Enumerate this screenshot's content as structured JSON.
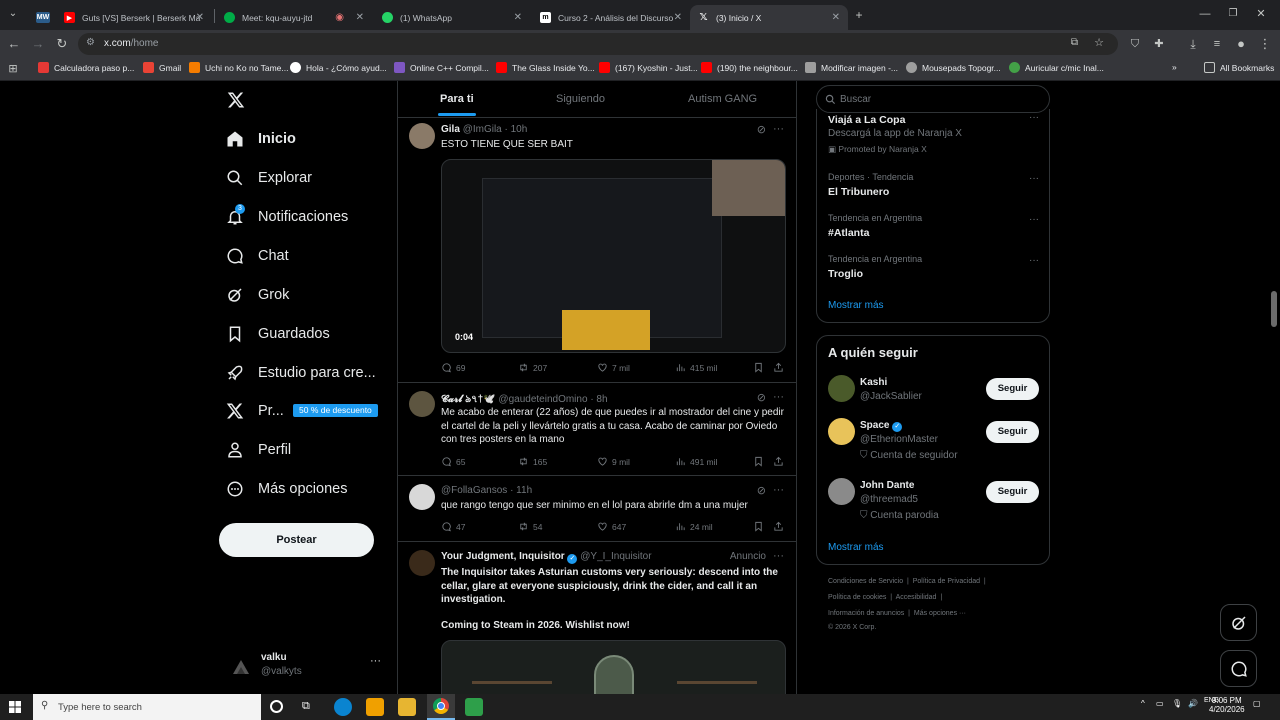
{
  "browser": {
    "tabs": [
      {
        "title": "Guts [VS] Berserk | Berserk Ma",
        "icon": "youtube-icon",
        "color": "#ff0000"
      },
      {
        "title": "Meet: kqu-auyu-jtd",
        "icon": "meet-icon",
        "color": "#00ac47"
      },
      {
        "title": "(1) WhatsApp",
        "icon": "whatsapp-icon",
        "color": "#25d366"
      },
      {
        "title": "Curso 2 - Análisis del Discurso",
        "icon": "moodle-icon",
        "color": "#ffffff"
      },
      {
        "title": "(3) Inicio / X",
        "icon": "x-icon",
        "color": "#ffffff"
      }
    ],
    "first_tab_label": "MW",
    "url_domain": "x.com",
    "url_path": "/home",
    "bookmarks": [
      {
        "label": "Calculadora paso p...",
        "color": "#e53935"
      },
      {
        "label": "Gmail",
        "color": "#ea4335"
      },
      {
        "label": "Uchi no Ko no Tame...",
        "color": "#f57c00"
      },
      {
        "label": "Hola - ¿Cómo ayud...",
        "color": "#ffffff"
      },
      {
        "label": "Online C++ Compil...",
        "color": "#7e57c2"
      },
      {
        "label": "The Glass Inside Yo...",
        "color": "#ff0000"
      },
      {
        "label": "(167) Kyoshin - Just...",
        "color": "#ff0000"
      },
      {
        "label": "(190) the neighbour...",
        "color": "#ff0000"
      },
      {
        "label": "Modificar imagen -...",
        "color": "#9e9e9e"
      },
      {
        "label": "Mousepads Topogr...",
        "color": "#9e9e9e"
      },
      {
        "label": "Auricular c/mic Inal...",
        "color": "#43a047"
      }
    ],
    "all_bookmarks": "All Bookmarks"
  },
  "nav": {
    "items": [
      {
        "label": "Inicio",
        "icon": "home-icon"
      },
      {
        "label": "Explorar",
        "icon": "search-icon"
      },
      {
        "label": "Notificaciones",
        "icon": "bell-icon"
      },
      {
        "label": "Chat",
        "icon": "chat-icon"
      },
      {
        "label": "Grok",
        "icon": "grok-icon"
      },
      {
        "label": "Guardados",
        "icon": "bookmark-icon"
      },
      {
        "label": "Estudio para cre...",
        "icon": "rocket-icon"
      },
      {
        "label": "Pr...",
        "icon": "x-logo-icon"
      },
      {
        "label": "Perfil",
        "icon": "person-icon"
      },
      {
        "label": "Más opciones",
        "icon": "more-circle-icon"
      }
    ],
    "notif_badge": "3",
    "premium_badge": "50 % de descuento",
    "post_button": "Postear",
    "account_name": "valku",
    "account_handle": "@valkyts"
  },
  "feed": {
    "tabs": [
      "Para ti",
      "Siguiendo",
      "Autism GANG"
    ],
    "tweets": [
      {
        "name": "Gila",
        "handle": "@ImGila",
        "time": "· 10h",
        "text": "ESTO TIENE QUE SER BAIT",
        "video_time": "0:04",
        "replies": "69",
        "reposts": "207",
        "likes": "7 mil",
        "views": "415 mil"
      },
      {
        "name": "𝓒𝓪𝓻𝓵 ঌ৭†🕊️",
        "handle": "@gaudeteindOmino",
        "time": "· 8h",
        "text": "Me acabo de enterar (22 años) de que puedes ir al mostrador del cine y pedir el cartel de la peli y llevártelo gratis a tu casa. Acabo de caminar por Oviedo con tres posters en la mano",
        "replies": "65",
        "reposts": "165",
        "likes": "9 mil",
        "views": "491 mil"
      },
      {
        "name": "",
        "handle": "@FollaGansos",
        "time": "· 11h",
        "text": "que rango tengo que ser minimo en el lol para abrirle dm a una mujer",
        "replies": "47",
        "reposts": "54",
        "likes": "647",
        "views": "24 mil"
      },
      {
        "name": "Your Judgment, Inquisitor",
        "handle": "@Y_I_Inquisitor",
        "time": "Anuncio",
        "text": "The Inquisitor takes Asturian customs very seriously: descend into the cellar, glare at everyone suspiciously, drink the cider, and call it an investigation.",
        "text2": "Coming to Steam in 2026. Wishlist now!"
      }
    ]
  },
  "right": {
    "search_placeholder": "Buscar",
    "trends": [
      {
        "title": "Viajá a La Copa",
        "sub": "Descargá la app de Naranja X",
        "promo": "Promoted by Naranja X"
      },
      {
        "meta": "Deportes · Tendencia",
        "title": "El Tribunero"
      },
      {
        "meta": "Tendencia en Argentina",
        "title": "#Atlanta"
      },
      {
        "meta": "Tendencia en Argentina",
        "title": "Troglio"
      }
    ],
    "show_more": "Mostrar más",
    "who_title": "A quién seguir",
    "who": [
      {
        "name": "Kashi",
        "handle": "@JackSablier",
        "sub": "",
        "color": "#4a5a2a"
      },
      {
        "name": "Space",
        "handle": "@EtherionMaster",
        "sub": "Cuenta de seguidor",
        "color": "#e8c35a"
      },
      {
        "name": "John Dante",
        "handle": "@threemad5",
        "sub": "Cuenta parodia",
        "color": "#888888"
      }
    ],
    "follow_label": "Seguir",
    "show_more2": "Mostrar más",
    "footer": [
      "Condiciones de Servicio",
      "Política de Privacidad",
      "Política de cookies",
      "Accesibilidad",
      "Información de anuncios",
      "Más opciones ···",
      "© 2026 X Corp."
    ]
  },
  "taskbar": {
    "search_placeholder": "Type here to search",
    "time": "9:06 PM",
    "date": "4/20/2026"
  }
}
